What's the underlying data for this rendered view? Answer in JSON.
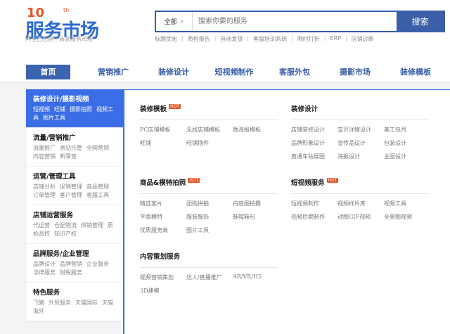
{
  "logo": {
    "ten": "10",
    "th": "th",
    "title": "服务市场",
    "subtitle": "阿里巴巴旗下商家服务市场"
  },
  "search": {
    "scope": "全部",
    "placeholder": "搜索你要的服务",
    "button": "搜索"
  },
  "hot_links": [
    "标题优化",
    "质检报告",
    "自动发货",
    "客服培训系统",
    "限时打折",
    "ERP",
    "店铺诊断"
  ],
  "nav": [
    "首页",
    "营销推广",
    "装修设计",
    "短视频制作",
    "客服外包",
    "摄影市场",
    "装修模板"
  ],
  "sidebar": [
    {
      "title": "装修设计/摄影视频",
      "subs": [
        "短视频",
        "旺铺",
        "摄影拍照",
        "视频工具",
        "图片工具"
      ]
    },
    {
      "title": "流量/营销推广",
      "subs": [
        "流量推广",
        "直钻托管",
        "全网营销",
        "内容营销",
        "新零售"
      ]
    },
    {
      "title": "运营/管理工具",
      "subs": [
        "店铺分析",
        "促销管理",
        "商品管理",
        "订单管理",
        "客户管理",
        "客服工具"
      ]
    },
    {
      "title": "店铺运营服务",
      "subs": [
        "代运营",
        "仓配物流",
        "供销管理",
        "质检品控",
        "知识产权"
      ]
    },
    {
      "title": "品牌服务/企业管理",
      "subs": [
        "品牌设计",
        "品牌营销",
        "企业服务",
        "法律服务",
        "财税服务"
      ]
    },
    {
      "title": "特色服务",
      "subs": [
        "飞猪",
        "外贸服务",
        "天猫国际",
        "天猫海外"
      ]
    }
  ],
  "hot_badge": "HOT",
  "sections": [
    {
      "title": "装修模板",
      "hot": true,
      "items": [
        "PC店铺模板",
        "无线店铺模板",
        "微海报模板",
        "旺铺",
        "旺铺插件"
      ]
    },
    {
      "title": "装修设计",
      "hot": false,
      "items": [
        "店铺装修设计",
        "宝贝详情设计",
        "美工包月",
        "品牌形象设计",
        "宣传品设计",
        "包装设计",
        "直通车钻展图",
        "海报设计",
        "主图设计"
      ]
    },
    {
      "title": "商品&模特拍照",
      "hot": true,
      "items": [
        "精选客片",
        "团购拼拍",
        "白底图拍摄",
        "平面模特",
        "服装服饰",
        "鞋帽箱包",
        "优质服务商",
        "图片工具"
      ]
    },
    {
      "title": "短视频服务",
      "hot": true,
      "items": [
        "短视频制作",
        "视频样片库",
        "视频工具",
        "视频后期制作",
        "动图GIF视频",
        "全景图视频"
      ]
    },
    {
      "title": "内容策划服务",
      "hot": false,
      "items": [
        "视频营销策划",
        "达人/直播推广",
        "AR/VR/H5",
        "3D建模"
      ]
    }
  ]
}
